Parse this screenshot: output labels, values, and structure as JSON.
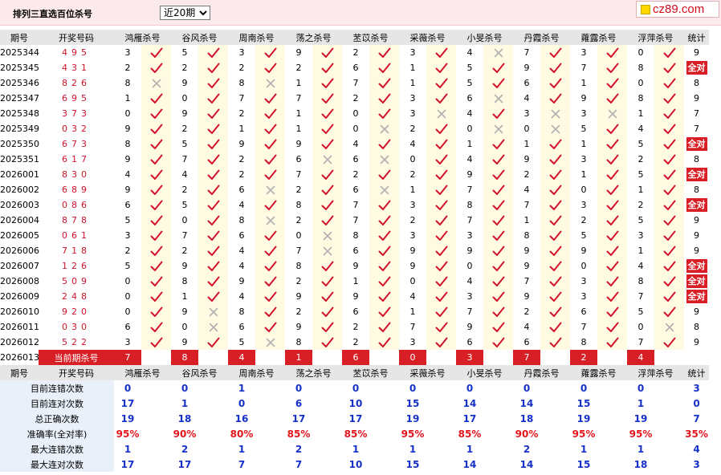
{
  "title": "排列三直选百位杀号",
  "range_select": {
    "selected": "近20期"
  },
  "logo": {
    "text": "cz89.com"
  },
  "colors": {
    "accent_red": "#d81f26",
    "check": "#d1122b",
    "cross": "#b0b0b0",
    "stat_blue": "#1531c8"
  },
  "headers": {
    "period": "期号",
    "open": "开奖号码",
    "experts": [
      "鸿雁杀号",
      "谷风杀号",
      "周南杀号",
      "荡之杀号",
      "苤苡杀号",
      "采薇杀号",
      "小旻杀号",
      "丹霞杀号",
      "蕹露杀号",
      "浮萍杀号"
    ],
    "stat": "统计"
  },
  "rows": [
    {
      "period": "2025344",
      "open": "495",
      "kills": [
        3,
        5,
        3,
        9,
        2,
        3,
        4,
        7,
        3,
        0
      ],
      "marks": [
        1,
        1,
        1,
        1,
        1,
        1,
        0,
        1,
        1,
        1
      ],
      "stat": "9"
    },
    {
      "period": "2025345",
      "open": "431",
      "kills": [
        2,
        2,
        2,
        2,
        6,
        1,
        5,
        9,
        7,
        8
      ],
      "marks": [
        1,
        1,
        1,
        1,
        1,
        1,
        1,
        1,
        1,
        1
      ],
      "stat": "全对"
    },
    {
      "period": "2025346",
      "open": "826",
      "kills": [
        8,
        9,
        8,
        1,
        7,
        1,
        5,
        6,
        1,
        0
      ],
      "marks": [
        0,
        1,
        0,
        1,
        1,
        1,
        1,
        1,
        1,
        1
      ],
      "stat": "8"
    },
    {
      "period": "2025347",
      "open": "695",
      "kills": [
        1,
        0,
        7,
        7,
        2,
        3,
        6,
        4,
        9,
        8
      ],
      "marks": [
        1,
        1,
        1,
        1,
        1,
        1,
        0,
        1,
        1,
        1
      ],
      "stat": "9"
    },
    {
      "period": "2025348",
      "open": "373",
      "kills": [
        0,
        9,
        2,
        1,
        0,
        3,
        4,
        3,
        3,
        1
      ],
      "marks": [
        1,
        1,
        1,
        1,
        1,
        0,
        1,
        0,
        0,
        1
      ],
      "stat": "7"
    },
    {
      "period": "2025349",
      "open": "032",
      "kills": [
        9,
        2,
        1,
        1,
        0,
        2,
        0,
        0,
        5,
        4
      ],
      "marks": [
        1,
        1,
        1,
        1,
        0,
        1,
        0,
        0,
        1,
        1
      ],
      "stat": "7"
    },
    {
      "period": "2025350",
      "open": "673",
      "kills": [
        8,
        5,
        9,
        9,
        4,
        4,
        1,
        1,
        1,
        5
      ],
      "marks": [
        1,
        1,
        1,
        1,
        1,
        1,
        1,
        1,
        1,
        1
      ],
      "stat": "全对"
    },
    {
      "period": "2025351",
      "open": "617",
      "kills": [
        9,
        7,
        2,
        6,
        6,
        0,
        4,
        9,
        3,
        2
      ],
      "marks": [
        1,
        1,
        1,
        0,
        0,
        1,
        1,
        1,
        1,
        1
      ],
      "stat": "8"
    },
    {
      "period": "2026001",
      "open": "830",
      "kills": [
        4,
        4,
        2,
        7,
        2,
        2,
        9,
        2,
        1,
        5
      ],
      "marks": [
        1,
        1,
        1,
        1,
        1,
        1,
        1,
        1,
        1,
        1
      ],
      "stat": "全对"
    },
    {
      "period": "2026002",
      "open": "689",
      "kills": [
        9,
        2,
        6,
        2,
        6,
        1,
        7,
        4,
        0,
        1
      ],
      "marks": [
        1,
        1,
        0,
        1,
        0,
        1,
        1,
        1,
        1,
        1
      ],
      "stat": "8"
    },
    {
      "period": "2026003",
      "open": "086",
      "kills": [
        6,
        5,
        4,
        8,
        7,
        3,
        8,
        7,
        3,
        2
      ],
      "marks": [
        1,
        1,
        1,
        1,
        1,
        1,
        1,
        1,
        1,
        1
      ],
      "stat": "全对"
    },
    {
      "period": "2026004",
      "open": "878",
      "kills": [
        5,
        0,
        8,
        2,
        7,
        2,
        7,
        1,
        2,
        5
      ],
      "marks": [
        1,
        1,
        0,
        1,
        1,
        1,
        1,
        1,
        1,
        1
      ],
      "stat": "9"
    },
    {
      "period": "2026005",
      "open": "061",
      "kills": [
        3,
        7,
        6,
        0,
        8,
        3,
        3,
        8,
        5,
        3
      ],
      "marks": [
        1,
        1,
        1,
        0,
        1,
        1,
        1,
        1,
        1,
        1
      ],
      "stat": "9"
    },
    {
      "period": "2026006",
      "open": "718",
      "kills": [
        2,
        2,
        4,
        7,
        6,
        9,
        9,
        9,
        9,
        1
      ],
      "marks": [
        1,
        1,
        1,
        0,
        1,
        1,
        1,
        1,
        1,
        1
      ],
      "stat": "9"
    },
    {
      "period": "2026007",
      "open": "126",
      "kills": [
        5,
        9,
        4,
        8,
        9,
        9,
        0,
        9,
        0,
        4
      ],
      "marks": [
        1,
        1,
        1,
        1,
        1,
        1,
        1,
        1,
        1,
        1
      ],
      "stat": "全对"
    },
    {
      "period": "2026008",
      "open": "509",
      "kills": [
        0,
        8,
        9,
        2,
        1,
        0,
        4,
        7,
        3,
        8
      ],
      "marks": [
        1,
        1,
        1,
        1,
        1,
        1,
        1,
        1,
        1,
        1
      ],
      "stat": "全对"
    },
    {
      "period": "2026009",
      "open": "248",
      "kills": [
        0,
        1,
        4,
        9,
        9,
        4,
        3,
        9,
        3,
        7
      ],
      "marks": [
        1,
        1,
        1,
        1,
        1,
        1,
        1,
        1,
        1,
        1
      ],
      "stat": "全对"
    },
    {
      "period": "2026010",
      "open": "920",
      "kills": [
        0,
        9,
        8,
        2,
        6,
        1,
        7,
        2,
        6,
        5
      ],
      "marks": [
        1,
        0,
        1,
        1,
        1,
        1,
        1,
        1,
        1,
        1
      ],
      "stat": "9"
    },
    {
      "period": "2026011",
      "open": "030",
      "kills": [
        6,
        0,
        6,
        9,
        2,
        7,
        9,
        4,
        7,
        0
      ],
      "marks": [
        1,
        0,
        1,
        1,
        1,
        1,
        1,
        1,
        1,
        0
      ],
      "stat": "8"
    },
    {
      "period": "2026012",
      "open": "522",
      "kills": [
        3,
        9,
        5,
        8,
        2,
        3,
        6,
        6,
        8,
        7
      ],
      "marks": [
        1,
        1,
        0,
        1,
        1,
        1,
        1,
        1,
        1,
        1
      ],
      "stat": "9"
    }
  ],
  "current": {
    "period": "2026013",
    "label": "当前期杀号",
    "kills": [
      "7",
      "8",
      "4",
      "1",
      "6",
      "0",
      "3",
      "7",
      "2",
      "4"
    ]
  },
  "stats": [
    {
      "label": "目前连错次数",
      "values": [
        "0",
        "0",
        "1",
        "0",
        "0",
        "0",
        "0",
        "0",
        "0",
        "0"
      ],
      "stat": "3"
    },
    {
      "label": "目前连对次数",
      "values": [
        "17",
        "1",
        "0",
        "6",
        "10",
        "15",
        "14",
        "14",
        "15",
        "1"
      ],
      "stat": "0"
    },
    {
      "label": "总正确次数",
      "values": [
        "19",
        "18",
        "16",
        "17",
        "17",
        "19",
        "17",
        "18",
        "19",
        "19"
      ],
      "stat": "7"
    },
    {
      "label": "准确率(全对率)",
      "values": [
        "95%",
        "90%",
        "80%",
        "85%",
        "85%",
        "95%",
        "85%",
        "90%",
        "95%",
        "95%"
      ],
      "stat": "35%"
    },
    {
      "label": "最大连错次数",
      "values": [
        "1",
        "2",
        "1",
        "2",
        "1",
        "1",
        "1",
        "2",
        "1",
        "1"
      ],
      "stat": "4"
    },
    {
      "label": "最大连对次数",
      "values": [
        "17",
        "17",
        "7",
        "7",
        "10",
        "15",
        "14",
        "14",
        "15",
        "18"
      ],
      "stat": "3"
    }
  ]
}
